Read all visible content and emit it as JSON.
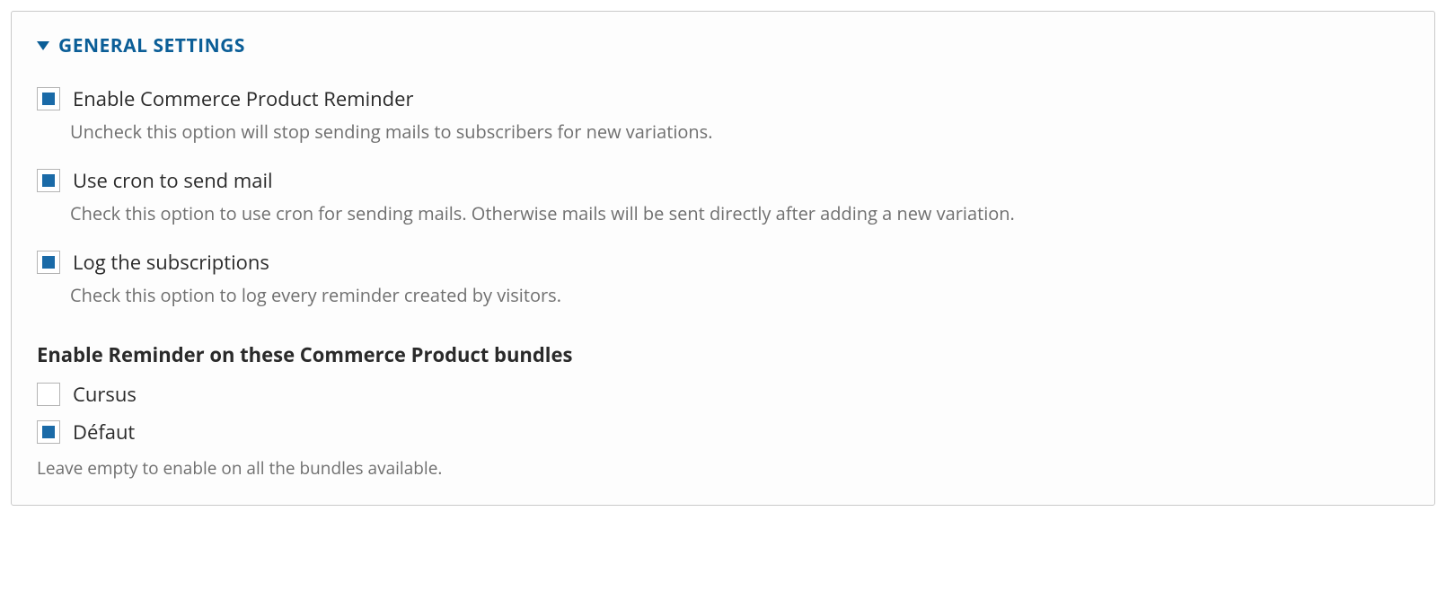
{
  "section": {
    "title": "GENERAL SETTINGS"
  },
  "settings": {
    "enable": {
      "checked": true,
      "label": "Enable Commerce Product Reminder",
      "description": "Uncheck this option will stop sending mails to subscribers for new variations."
    },
    "cron": {
      "checked": true,
      "label": "Use cron to send mail",
      "description": "Check this option to use cron for sending mails. Otherwise mails will be sent directly after adding a new variation."
    },
    "log": {
      "checked": true,
      "label": "Log the subscriptions",
      "description": "Check this option to log every reminder created by visitors."
    }
  },
  "bundles": {
    "group_label": "Enable Reminder on these Commerce Product bundles",
    "items": [
      {
        "checked": false,
        "label": "Cursus"
      },
      {
        "checked": true,
        "label": "Défaut"
      }
    ],
    "help": "Leave empty to enable on all the bundles available."
  }
}
